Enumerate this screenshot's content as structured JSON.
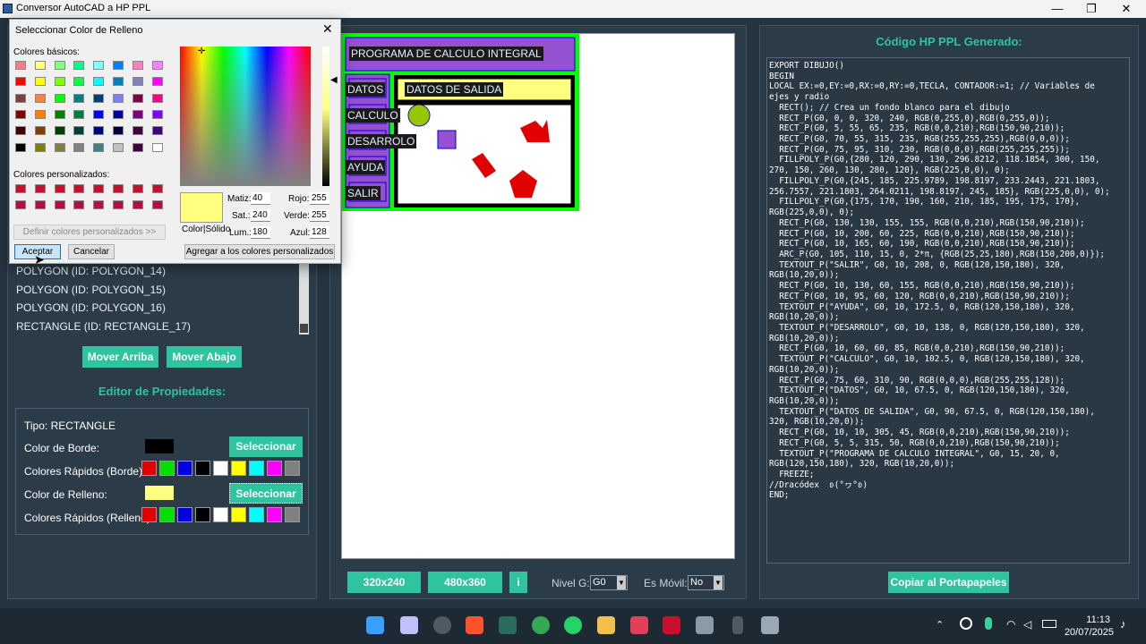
{
  "window": {
    "title": "Conversor AutoCAD a HP PPL",
    "minimize": "—",
    "maximize": "❐",
    "close": "✕"
  },
  "left": {
    "list_items": [
      "POLYGON (ID: POLYGON_14)",
      "POLYGON (ID: POLYGON_15)",
      "POLYGON (ID: POLYGON_16)",
      "RECTANGLE (ID: RECTANGLE_17)"
    ],
    "move_up": "Mover Arriba",
    "move_down": "Mover Abajo",
    "editor_title": "Editor de Propiedades:",
    "tipo": "Tipo: RECTANGLE",
    "border_label": "Color de Borde:",
    "border_color": "#000000",
    "fill_color": "#ffff80",
    "select_btn": "Seleccionar",
    "quick_border_label": "Colores Rápidos (Borde):",
    "fill_label": "Color de Relleno:",
    "select_fill_btn": "Seleccionar",
    "quick_fill_label": "Colores Rápidos (Relleno):",
    "quick_colors": [
      "#e00000",
      "#00e000",
      "#0000e0",
      "#000000",
      "#ffffff",
      "#ffff00",
      "#00ffff",
      "#ff00ff",
      "#808080"
    ]
  },
  "canvas": {
    "texts": {
      "title": "PROGRAMA DE CALCULO INTEGRAL",
      "datos": "DATOS",
      "calculo": "CALCULO",
      "desarrolo": "DESARROLO",
      "ayuda": "AYUDA",
      "salir": "SALIR",
      "salida": "DATOS DE SALIDA"
    },
    "size_btn_1": "320x240",
    "size_btn_2": "480x360",
    "size_btn_3": "i",
    "nivel_label": "Nivel G:",
    "nivel_value": "G0",
    "movil_label": "Es Móvil:",
    "movil_value": "No"
  },
  "code": {
    "title": "Código HP PPL Generado:",
    "text": "EXPORT DIBUJO()\nBEGIN\nLOCAL EX:=0,EY:=0,RX:=0,RY:=0,TECLA, CONTADOR:=1; // Variables de\nejes y radio\n  RECT(); // Crea un fondo blanco para el dibujo\n  RECT_P(G0, 0, 0, 320, 240, RGB(0,255,0),RGB(0,255,0));\n  RECT_P(G0, 5, 55, 65, 235, RGB(0,0,210),RGB(150,90,210));\n  RECT_P(G0, 70, 55, 315, 235, RGB(255,255,255),RGB(0,0,0));\n  RECT_P(G0, 75, 95, 310, 230, RGB(0,0,0),RGB(255,255,255));\n  FILLPOLY_P(G0,{280, 120, 290, 130, 296.8212, 118.1854, 300, 150,\n270, 150, 260, 130, 280, 120}, RGB(225,0,0), 0);\n  FILLPOLY_P(G0,{245, 185, 225.9789, 198.8197, 233.2443, 221.1803,\n256.7557, 221.1803, 264.0211, 198.8197, 245, 185}, RGB(225,0,0), 0);\n  FILLPOLY_P(G0,{175, 170, 190, 160, 210, 185, 195, 175, 170},\nRGB(225,0,0), 0);\n  RECT_P(G0, 130, 130, 155, 155, RGB(0,0,210),RGB(150,90,210));\n  RECT_P(G0, 10, 200, 60, 225, RGB(0,0,210),RGB(150,90,210));\n  RECT_P(G0, 10, 165, 60, 190, RGB(0,0,210),RGB(150,90,210));\n  ARC_P(G0, 105, 110, 15, 0, 2*π, {RGB(25,25,180),RGB(150,200,0)});\n  TEXTOUT_P(\"SALIR\", G0, 10, 208, 0, RGB(120,150,180), 320,\nRGB(10,20,0));\n  RECT_P(G0, 10, 130, 60, 155, RGB(0,0,210),RGB(150,90,210));\n  RECT_P(G0, 10, 95, 60, 120, RGB(0,0,210),RGB(150,90,210));\n  TEXTOUT_P(\"AYUDA\", G0, 10, 172.5, 0, RGB(120,150,180), 320,\nRGB(10,20,0));\n  TEXTOUT_P(\"DESARROLO\", G0, 10, 138, 0, RGB(120,150,180), 320,\nRGB(10,20,0));\n  RECT_P(G0, 10, 60, 60, 85, RGB(0,0,210),RGB(150,90,210));\n  TEXTOUT_P(\"CALCULO\", G0, 10, 102.5, 0, RGB(120,150,180), 320,\nRGB(10,20,0));\n  RECT_P(G0, 75, 60, 310, 90, RGB(0,0,0),RGB(255,255,128));\n  TEXTOUT_P(\"DATOS\", G0, 10, 67.5, 0, RGB(120,150,180), 320,\nRGB(10,20,0));\n  TEXTOUT_P(\"DATOS DE SALIDA\", G0, 90, 67.5, 0, RGB(120,150,180),\n320, RGB(10,20,0));\n  RECT_P(G0, 10, 10, 305, 45, RGB(0,0,210),RGB(150,90,210));\n  RECT_P(G0, 5, 5, 315, 50, RGB(0,0,210),RGB(150,90,210));\n  TEXTOUT_P(\"PROGRAMA DE CALCULO INTEGRAL\", G0, 15, 20, 0,\nRGB(120,150,180), 320, RGB(10,20,0));\n  FREEZE;\n//Dracódex  ʚ(°ヮ°ʚ)\nEND;",
    "copy_btn": "Copiar al Portapapeles"
  },
  "dialog": {
    "title": "Seleccionar Color de Relleno",
    "basic_label": "Colores básicos:",
    "basic_colors": [
      "#f28080",
      "#ffff80",
      "#80ff80",
      "#00ff80",
      "#80ffff",
      "#0080ff",
      "#ff80c0",
      "#ff80ff",
      "#ff0000",
      "#ffff00",
      "#80ff00",
      "#00ff40",
      "#00ffff",
      "#0080c0",
      "#8080c0",
      "#ff00ff",
      "#804040",
      "#ff8040",
      "#00ff00",
      "#008080",
      "#004080",
      "#8080ff",
      "#800040",
      "#ff0080",
      "#800000",
      "#ff8000",
      "#008000",
      "#008040",
      "#0000ff",
      "#0000a0",
      "#800080",
      "#8000ff",
      "#400000",
      "#804000",
      "#004000",
      "#004040",
      "#000080",
      "#000040",
      "#400040",
      "#400080",
      "#000000",
      "#808000",
      "#808040",
      "#808080",
      "#408080",
      "#c0c0c0",
      "#400040",
      "#ffffff"
    ],
    "custom_label": "Colores personalizados:",
    "custom_colors": [
      "#c8102e",
      "#c8102e",
      "#c8102e",
      "#c8102e",
      "#c8102e",
      "#c8102e",
      "#c8102e",
      "#c8102e",
      "#b01040",
      "#b01040",
      "#b01040",
      "#b01040",
      "#b01040",
      "#b01040",
      "#b01040",
      "#b01040"
    ],
    "define_btn": "Definir colores personalizados >>",
    "preview_label": "Color|Sólido",
    "preview_color": "#ffff80",
    "matiz_label": "Matiz:",
    "matiz": "40",
    "sat_label": "Sat.:",
    "sat": "240",
    "lum_label": "Lum.:",
    "lum": "180",
    "rojo_label": "Rojo:",
    "rojo": "255",
    "verde_label": "Verde:",
    "verde": "255",
    "azul_label": "Azul:",
    "azul": "128",
    "accept_btn": "Aceptar",
    "cancel_btn": "Cancelar",
    "add_custom_btn": "Agregar a los colores personalizados"
  },
  "taskbar": {
    "time": "11:13",
    "date": "20/07/2025"
  }
}
